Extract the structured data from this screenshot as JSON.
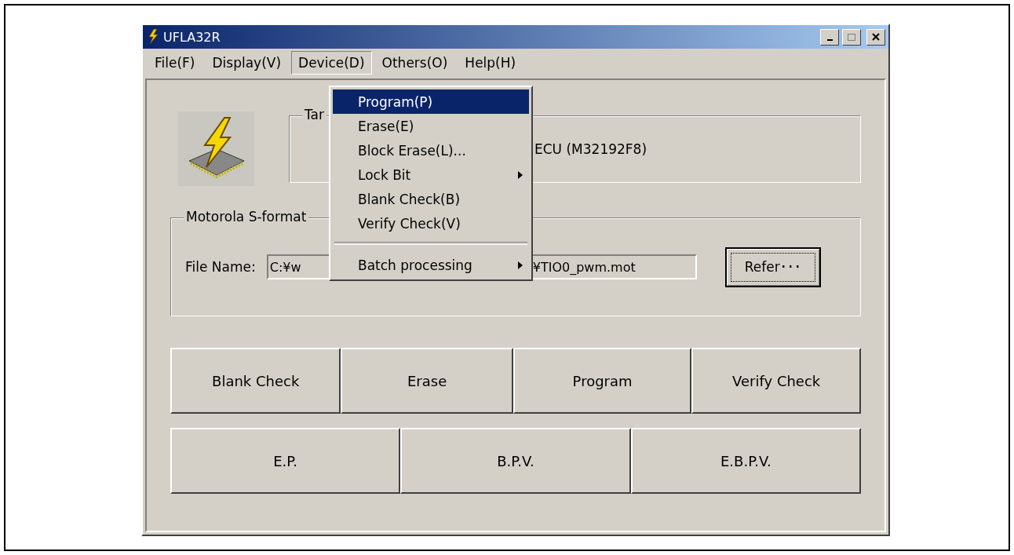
{
  "window": {
    "title": "UFLA32R"
  },
  "menu_bar": [
    {
      "label": "File(F)",
      "selected": false
    },
    {
      "label": "Display(V)",
      "selected": false
    },
    {
      "label": "Device(D)",
      "selected": true
    },
    {
      "label": "Others(O)",
      "selected": false
    },
    {
      "label": "Help(H)",
      "selected": false
    }
  ],
  "target_group": {
    "label": "Tar",
    "value": "ECU (M32192F8)"
  },
  "file_group": {
    "label": "Motorola S-format",
    "file_name_label": "File Name:",
    "value_start": "C:¥w",
    "value_end": "¥TIO0_pwm.mot",
    "refer_button": "Refer･･･"
  },
  "buttons_row_1": [
    "Blank Check",
    "Erase",
    "Program",
    "Verify Check"
  ],
  "buttons_row_2": [
    "E.P.",
    "B.P.V.",
    "E.B.P.V."
  ],
  "dropdown_menu": [
    {
      "label": "Program(P)",
      "selected": true,
      "submenu": false
    },
    {
      "label": "Erase(E)",
      "selected": false,
      "submenu": false
    },
    {
      "label": "Block Erase(L)...",
      "selected": false,
      "submenu": false
    },
    {
      "label": "Lock Bit",
      "selected": false,
      "submenu": true
    },
    {
      "label": "Blank Check(B)",
      "selected": false,
      "submenu": false
    },
    {
      "label": "Verify Check(V)",
      "selected": false,
      "submenu": false
    },
    {
      "kind": "separator"
    },
    {
      "label": "Batch processing",
      "selected": false,
      "submenu": true
    }
  ]
}
